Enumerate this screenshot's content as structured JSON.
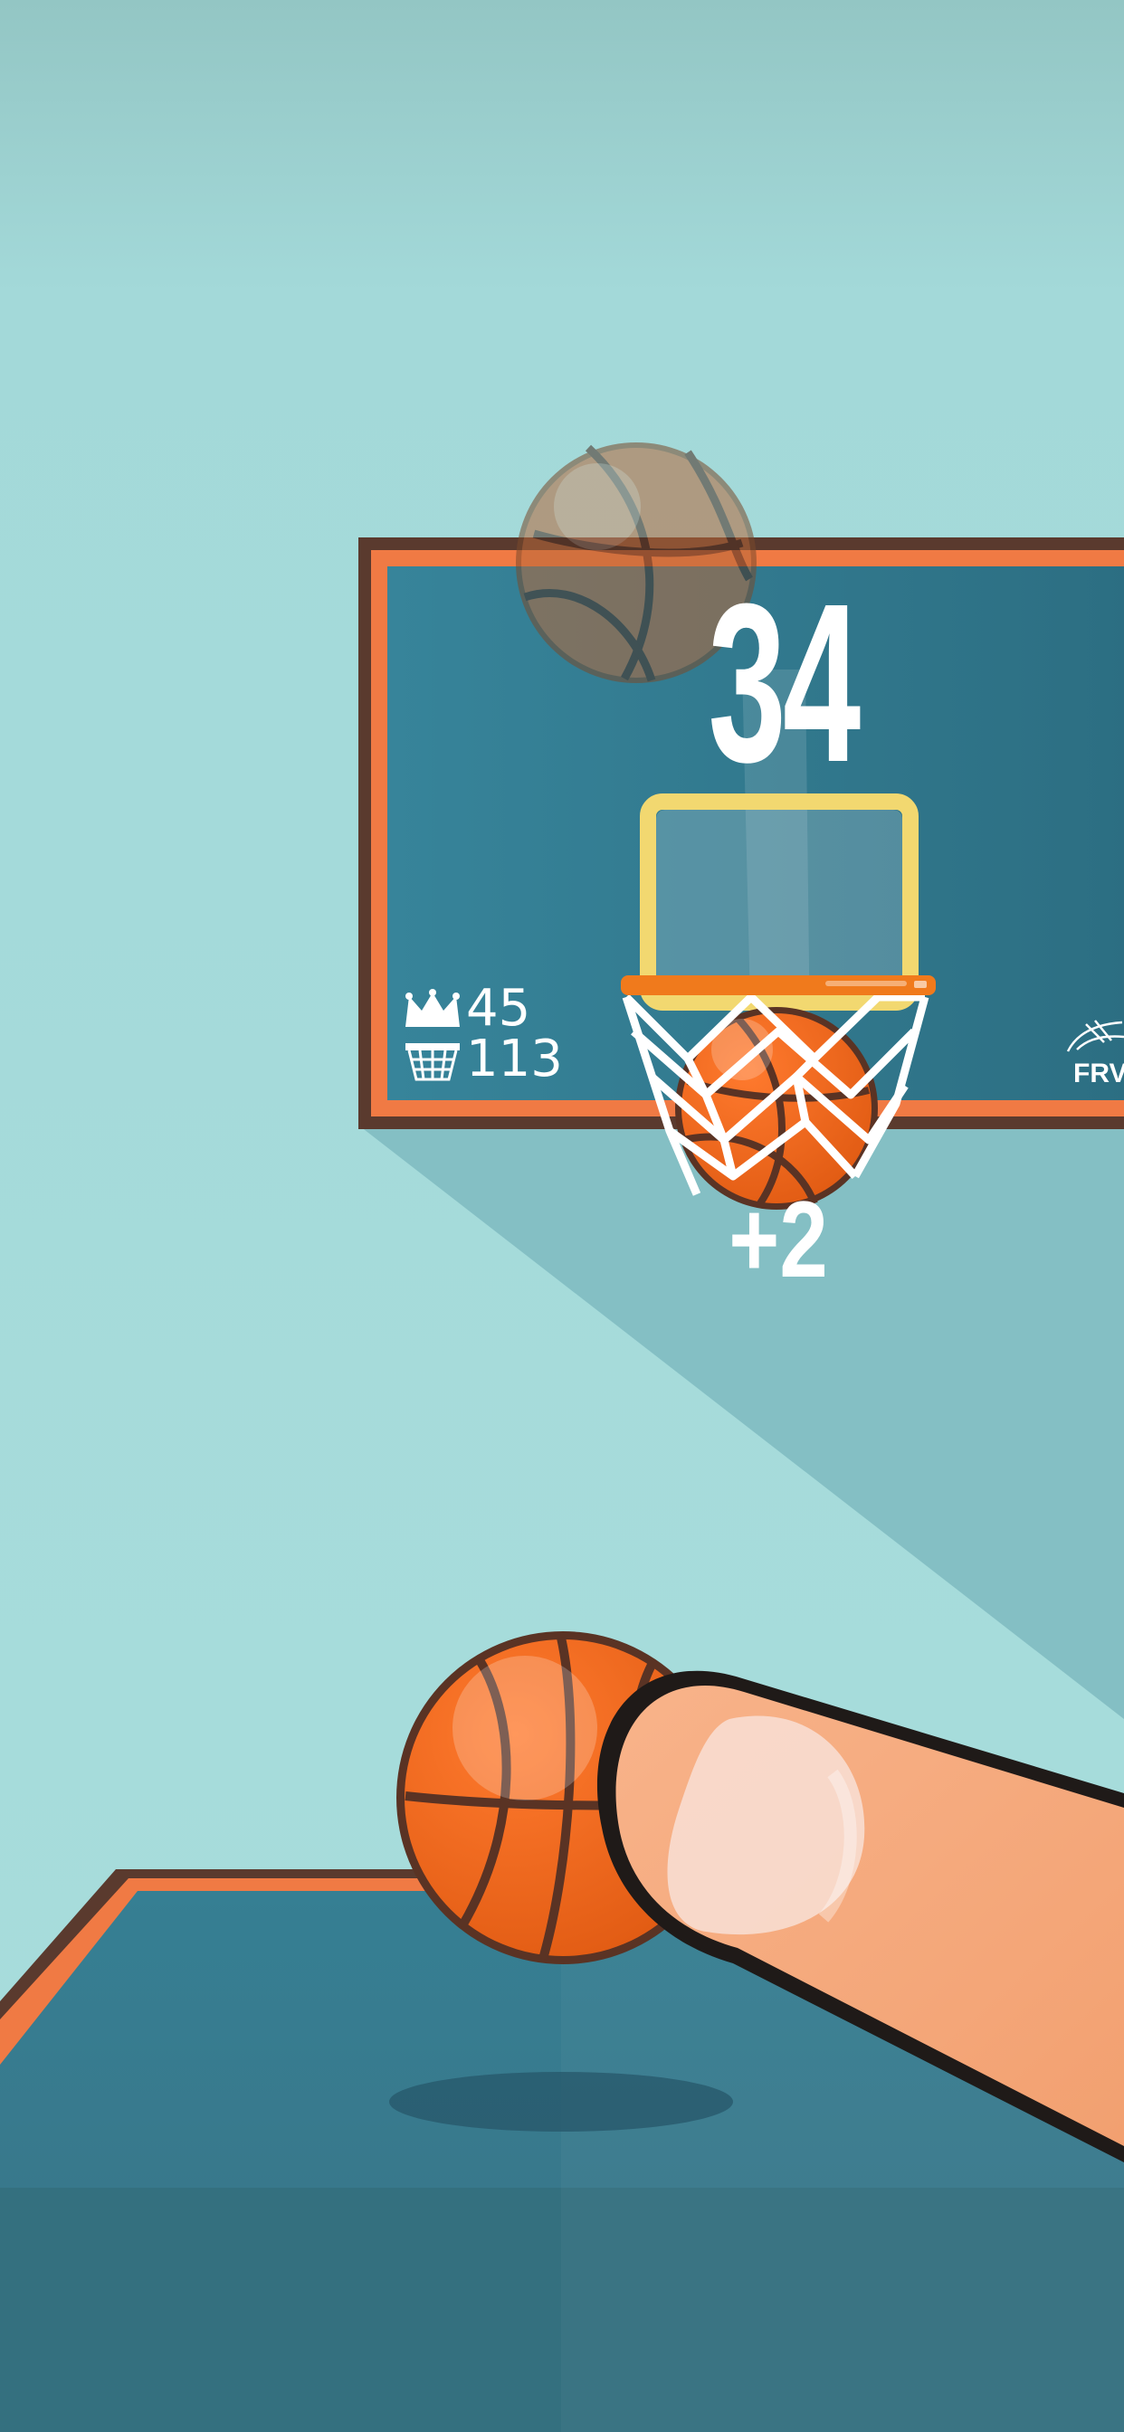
{
  "hud": {
    "score": "34",
    "best_score": "45",
    "total_baskets": "113",
    "points_popup": "+2",
    "brand": "FRV"
  },
  "icons": {
    "best": "crown-icon",
    "total": "basket-icon",
    "brand": "frv-logo-icon"
  },
  "colors": {
    "background": "#a6dcdc",
    "backboard": "#2f7388",
    "backboard_border": "#f07a44",
    "rim": "#f07a1c",
    "ball": "#f0671e",
    "skin": "#f6a97f"
  }
}
